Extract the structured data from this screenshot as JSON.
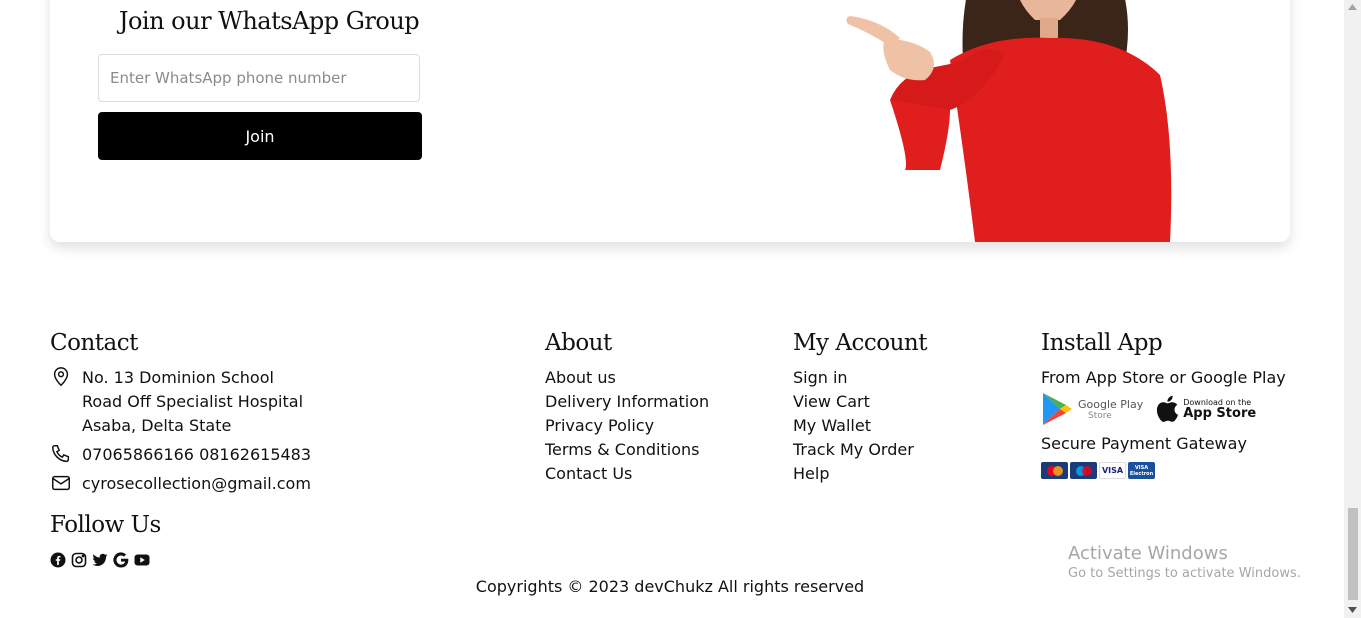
{
  "promo": {
    "title": "Join our WhatsApp Group",
    "phone_placeholder": "Enter WhatsApp phone number",
    "join_label": "Join"
  },
  "contact": {
    "heading": "Contact",
    "address_line1": "No. 13 Dominion School",
    "address_line2": "Road Off Specialist Hospital",
    "address_line3": "Asaba, Delta State",
    "phones": "07065866166 08162615483",
    "email": "cyrosecollection@gmail.com"
  },
  "follow": {
    "heading": "Follow Us",
    "icons": [
      "facebook-icon",
      "instagram-icon",
      "twitter-icon",
      "google-icon",
      "youtube-icon"
    ]
  },
  "about": {
    "heading": "About",
    "links": [
      "About us",
      "Delivery Information",
      "Privacy Policy",
      "Terms & Conditions",
      "Contact Us"
    ]
  },
  "account": {
    "heading": "My Account",
    "links": [
      "Sign in",
      "View Cart",
      "My Wallet",
      "Track My Order",
      "Help"
    ]
  },
  "install": {
    "heading": "Install App",
    "subtitle": "From App Store or Google Play",
    "google_play_line1": "Google Play",
    "google_play_line2": "Store",
    "app_store_line1": "Download on the",
    "app_store_line2": "App Store",
    "payment_heading": "Secure Payment Gateway",
    "payment_cards": [
      "MasterCard",
      "Maestro",
      "VISA",
      "VISA Electron"
    ]
  },
  "copyright": "Copyrights © 2023 devChukz All rights reserved",
  "activate_windows": {
    "title": "Activate Windows",
    "subtitle": "Go to Settings to activate Windows."
  },
  "colors": {
    "accent_black": "#000000",
    "whatsapp_green": "#25d366",
    "sweater_red": "#e01e1e"
  }
}
